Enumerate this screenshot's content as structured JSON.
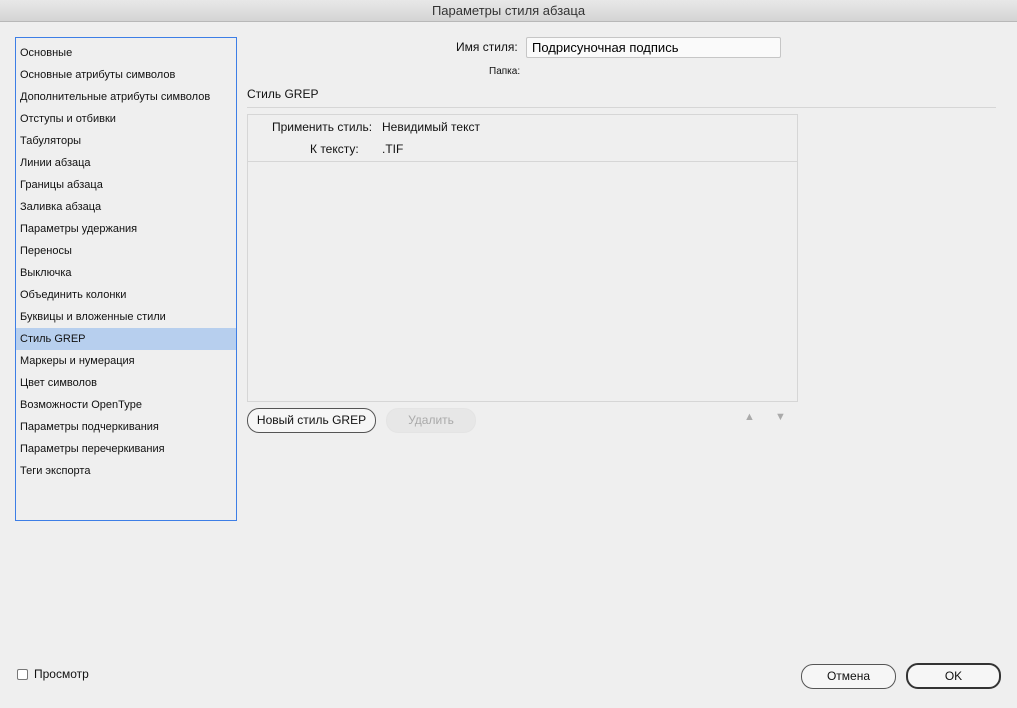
{
  "window": {
    "title": "Параметры стиля абзаца"
  },
  "sidebar": {
    "items": [
      "Основные",
      "Основные атрибуты символов",
      "Дополнительные атрибуты символов",
      "Отступы и отбивки",
      "Табуляторы",
      "Линии абзаца",
      "Границы абзаца",
      "Заливка абзаца",
      "Параметры удержания",
      "Переносы",
      "Выключка",
      "Объединить колонки",
      "Буквицы и вложенные стили",
      "Стиль GREP",
      "Маркеры и нумерация",
      "Цвет символов",
      "Возможности OpenType",
      "Параметры подчеркивания",
      "Параметры перечеркивания",
      "Теги экспорта"
    ],
    "selected_index": 13
  },
  "style_name": {
    "label": "Имя стиля:",
    "value": "Подрисуночная подпись"
  },
  "folder": {
    "label": "Папка:"
  },
  "section": {
    "title": "Стиль GREP"
  },
  "grep": {
    "apply_label": "Применить стиль:",
    "apply_value": "Невидимый текст",
    "to_text_label": "К тексту:",
    "to_text_value": ".TIF"
  },
  "buttons": {
    "new": "Новый стиль GREP",
    "delete": "Удалить",
    "cancel": "Отмена",
    "ok": "OK"
  },
  "preview": {
    "label": "Просмотр",
    "checked": false
  },
  "colors": {
    "selection": "#b7cfee",
    "focus": "#3d7ee6"
  }
}
